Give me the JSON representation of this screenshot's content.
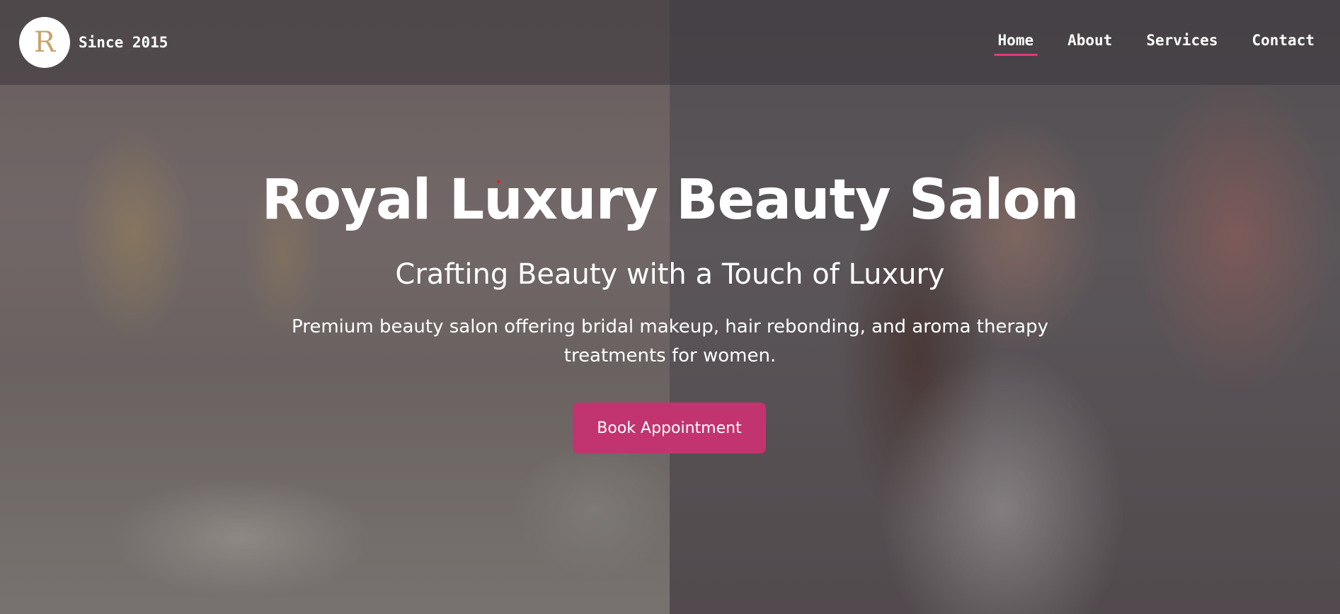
{
  "header": {
    "logo_letter": "R",
    "since_text": "Since 2015",
    "nav": [
      {
        "label": "Home",
        "active": true
      },
      {
        "label": "About",
        "active": false
      },
      {
        "label": "Services",
        "active": false
      },
      {
        "label": "Contact",
        "active": false
      }
    ]
  },
  "hero": {
    "title": "Royal Luxury Beauty Salon",
    "subtitle": "Crafting Beauty with a Touch of Luxury",
    "description": "Premium beauty salon offering bridal makeup, hair rebonding, and aroma therapy treatments for women.",
    "cta_label": "Book Appointment"
  },
  "colors": {
    "accent": "#c2346f",
    "nav_underline": "#e0397f"
  }
}
